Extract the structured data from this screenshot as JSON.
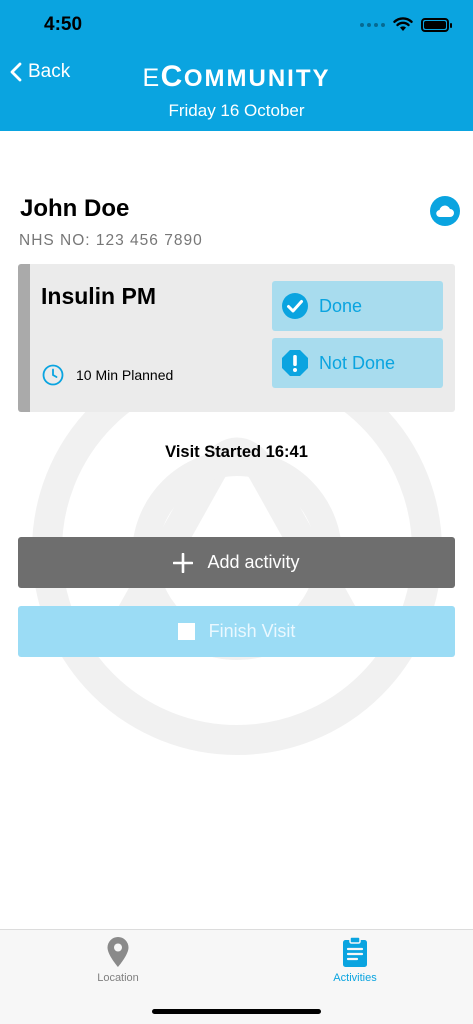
{
  "status_bar": {
    "time": "4:50"
  },
  "header": {
    "back_label": "Back",
    "title_e": "E",
    "title_c": "C",
    "title_rest": "OMMUNITY",
    "date": "Friday 16 October"
  },
  "patient": {
    "name": "John Doe",
    "nhs_number": "NHS NO: 123 456 7890"
  },
  "activity": {
    "name": "Insulin PM",
    "planned": "10 Min Planned",
    "done_label": "Done",
    "not_done_label": "Not Done"
  },
  "visit": {
    "started_text": "Visit Started 16:41"
  },
  "actions": {
    "add_label": "Add activity",
    "finish_label": "Finish Visit"
  },
  "tabs": [
    {
      "label": "Location",
      "icon": "location-pin-icon",
      "active": false
    },
    {
      "label": "Activities",
      "icon": "clipboard-icon",
      "active": true
    }
  ],
  "colors": {
    "brand": "#0aa4e0",
    "status_button_bg": "#a8dcee",
    "add_button_bg": "#6e6e6e",
    "finish_button_bg": "#9bdcf5",
    "card_bg": "#ebebeb"
  }
}
